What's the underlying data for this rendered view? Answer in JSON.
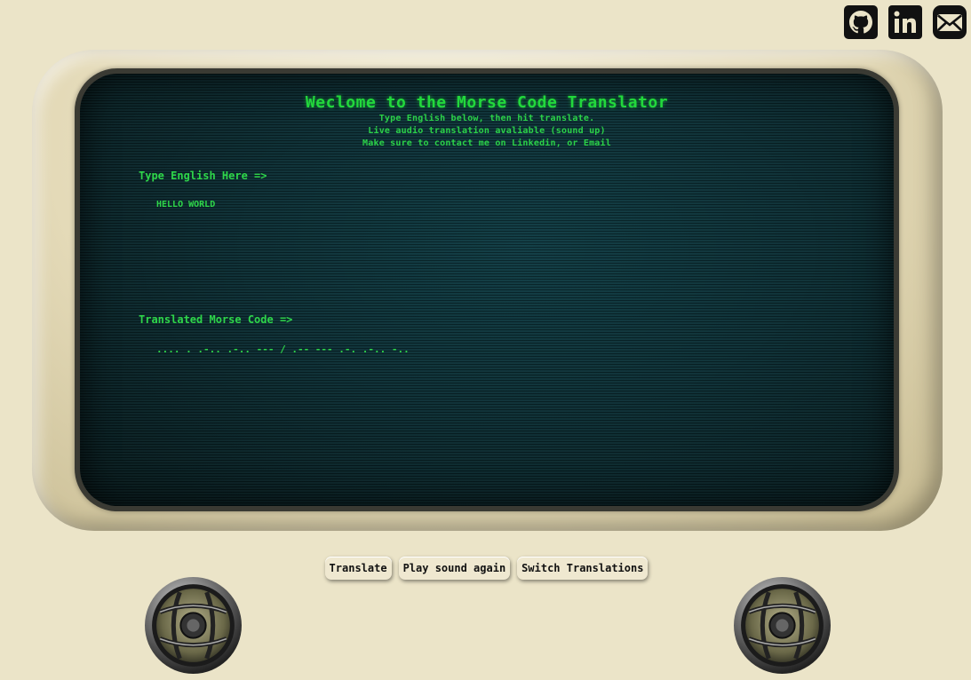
{
  "social": {
    "github_icon": "github-icon",
    "linkedin_icon": "linkedin-icon",
    "email_icon": "email-icon"
  },
  "screen": {
    "title": "Weclome to the Morse Code Translator",
    "subtitle_lines": [
      "Type English below, then hit translate.",
      "Live audio translation avaliable (sound up)",
      "Make sure to contact me on Linkedin, or Email"
    ],
    "input_label": "Type English Here =>",
    "input_value": "HELLO WORLD",
    "output_label": "Translated Morse Code =>",
    "output_value": ".... . .-.. .-.. --- / .-- --- .-. .-.. -.."
  },
  "controls": {
    "translate_label": "Translate",
    "play_label": "Play sound again",
    "switch_label": "Switch Translations"
  },
  "colors": {
    "page_background": "#ebe4c8",
    "screen_text": "#2ed64a",
    "screen_background": "#0c2f35"
  }
}
